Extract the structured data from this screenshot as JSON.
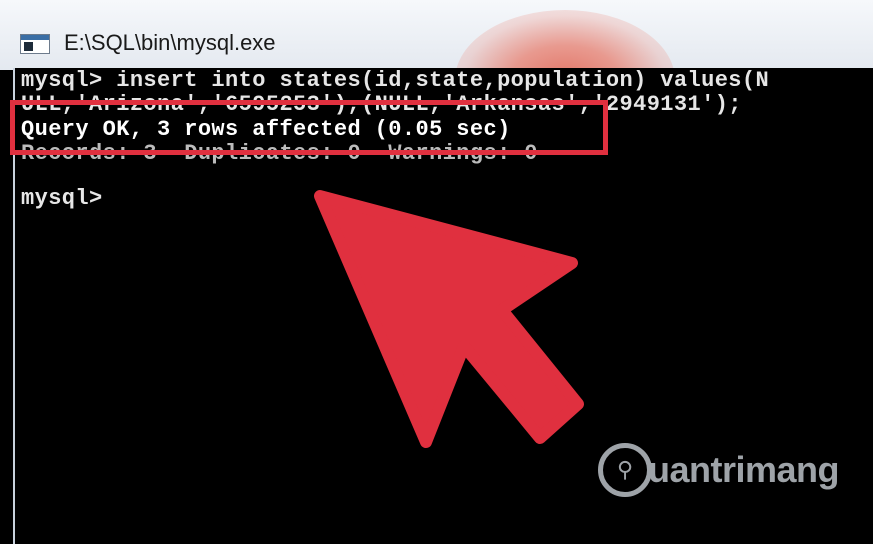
{
  "window": {
    "title": "E:\\SQL\\bin\\mysql.exe",
    "icon": "console-window-icon"
  },
  "console": {
    "lines": [
      "mysql> insert into states(id,state,population) values(N",
      "ULL,'Arizona','6595253'),(NULL,'Arkansas','2949131');",
      "Query OK, 3 rows affected (0.05 sec)",
      "Records: 3  Duplicates: 0  Warnings: 0",
      "mysql>"
    ]
  },
  "annotation": {
    "highlight_color": "#e0303f",
    "arrow_color": "#e0303f"
  },
  "watermark": {
    "text": "uantrimang",
    "logo_icon": "lightbulb-icon"
  }
}
